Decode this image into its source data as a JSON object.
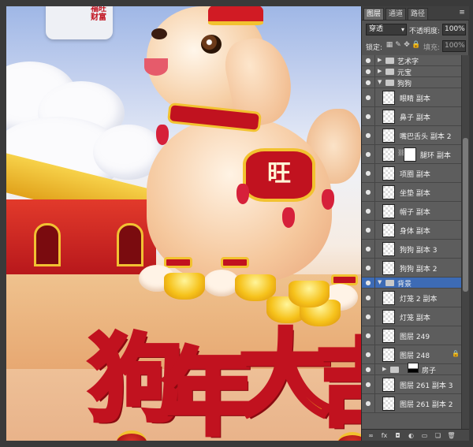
{
  "artwork": {
    "seal_text": "福旺财富",
    "bib_character": "旺",
    "calligraphy": [
      "狗",
      "年",
      "大",
      "吉"
    ]
  },
  "panel": {
    "tabs": [
      "图层",
      "通道",
      "路径"
    ],
    "active_tab": "图层",
    "menu_glyph": "≡",
    "blend_mode": "穿透",
    "opacity_label": "不透明度:",
    "opacity_value": "100%",
    "lock_label": "锁定:",
    "fill_label": "填充:",
    "fill_value": "100%",
    "layers": [
      {
        "name": "艺术字",
        "type": "group",
        "expanded": false,
        "visible": true
      },
      {
        "name": "元宝",
        "type": "group",
        "expanded": false,
        "visible": true
      },
      {
        "name": "狗狗",
        "type": "group",
        "expanded": true,
        "visible": true
      },
      {
        "name": "眼睛 副本",
        "type": "layer",
        "visible": true
      },
      {
        "name": "鼻子 副本",
        "type": "layer",
        "visible": true
      },
      {
        "name": "嘴巴舌头 副本 2",
        "type": "layer",
        "visible": true
      },
      {
        "name": "腿环 副本",
        "type": "layer",
        "visible": true,
        "has_mask": true
      },
      {
        "name": "项圈 副本",
        "type": "layer",
        "visible": true
      },
      {
        "name": "坐垫 副本",
        "type": "layer",
        "visible": true
      },
      {
        "name": "帽子 副本",
        "type": "layer",
        "visible": true
      },
      {
        "name": "身体 副本",
        "type": "layer",
        "visible": true
      },
      {
        "name": "狗狗 副本 3",
        "type": "layer",
        "visible": true
      },
      {
        "name": "狗狗 副本 2",
        "type": "layer",
        "visible": true
      },
      {
        "name": "背景",
        "type": "group",
        "expanded": true,
        "visible": true,
        "selected": true
      },
      {
        "name": "灯笼 2 副本",
        "type": "layer",
        "visible": true
      },
      {
        "name": "灯笼 副本",
        "type": "layer",
        "visible": true
      },
      {
        "name": "图层 249",
        "type": "layer",
        "visible": true
      },
      {
        "name": "图层 248",
        "type": "layer",
        "visible": true,
        "locked": true
      },
      {
        "name": "房子",
        "type": "group",
        "expanded": false,
        "visible": true,
        "has_mask": true
      },
      {
        "name": "图层 261 副本 3",
        "type": "layer",
        "visible": true
      },
      {
        "name": "图层 261 副本 2",
        "type": "layer",
        "visible": true
      }
    ],
    "bottom_icons": [
      "link-icon",
      "fx-icon",
      "mask-icon",
      "adjustment-icon",
      "folder-icon",
      "new-layer-icon",
      "trash-icon"
    ]
  }
}
